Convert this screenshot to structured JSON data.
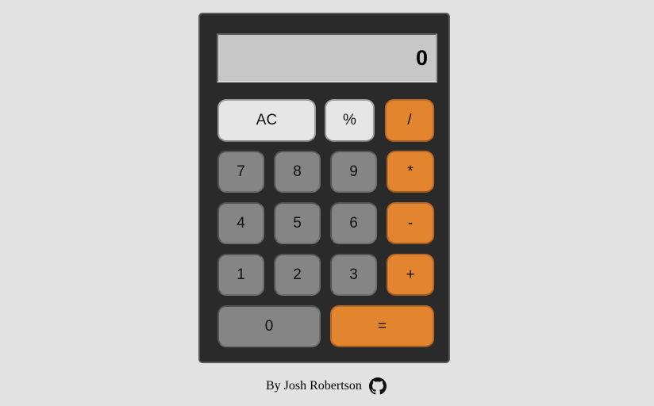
{
  "display": {
    "value": "0"
  },
  "keys": {
    "ac": "AC",
    "percent": "%",
    "divide": "/",
    "seven": "7",
    "eight": "8",
    "nine": "9",
    "multiply": "*",
    "four": "4",
    "five": "5",
    "six": "6",
    "subtract": "-",
    "one": "1",
    "two": "2",
    "three": "3",
    "add": "+",
    "zero": "0",
    "equals": "="
  },
  "footer": {
    "credit": "By Josh Robertson",
    "icon": "github-icon"
  },
  "colors": {
    "background": "#e2e2e2",
    "body": "#2a2a2a",
    "display": "#c7c7c7",
    "light_key": "#e6e6e6",
    "number_key": "#858585",
    "operator_key": "#e3852f"
  }
}
